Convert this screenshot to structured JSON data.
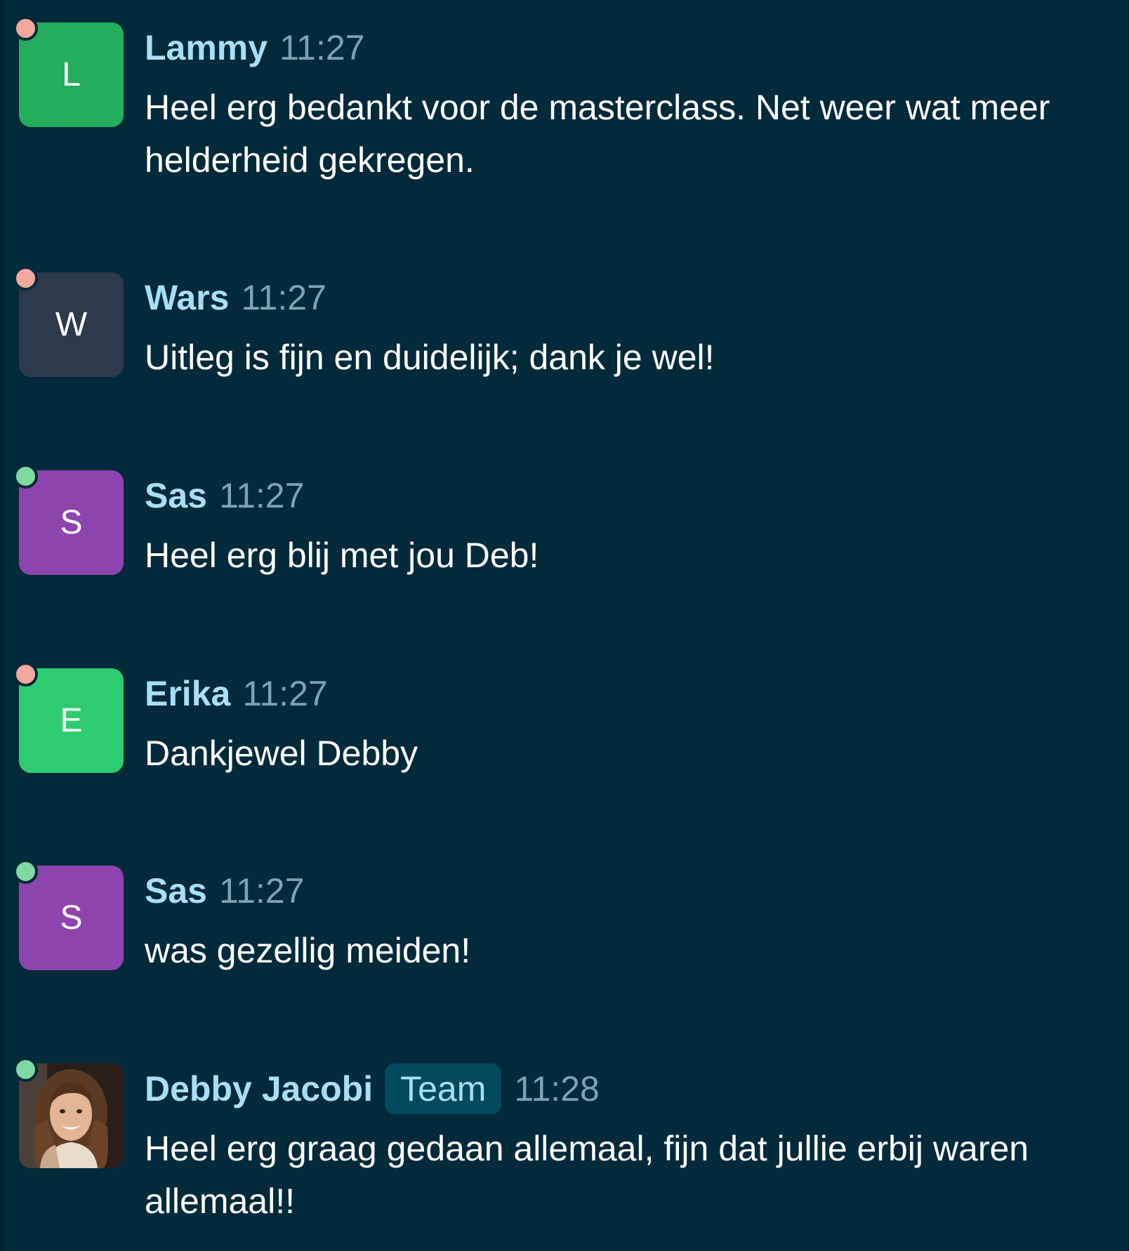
{
  "colors": {
    "background": "#032a3a",
    "name_color": "#a7dff6",
    "time_color": "#7ea2b2",
    "text_color": "#ffffff",
    "presence_away": "#f4a89c",
    "presence_online": "#7fd9a0"
  },
  "messages": [
    {
      "author": "Lammy",
      "initial": "L",
      "avatar_color": "#23ad5c",
      "presence": "away",
      "time": "11:27",
      "text": "Heel erg bedankt voor de masterclass. Net weer wat meer helderheid gekregen."
    },
    {
      "author": "Wars",
      "initial": "W",
      "avatar_color": "#2d3a4b",
      "presence": "away",
      "time": "11:27",
      "text": "Uitleg is fijn en duidelijk; dank je wel!"
    },
    {
      "author": "Sas",
      "initial": "S",
      "avatar_color": "#8e44ad",
      "presence": "online",
      "time": "11:27",
      "text": "Heel erg blij met jou Deb!"
    },
    {
      "author": "Erika",
      "initial": "E",
      "avatar_color": "#2ecc71",
      "presence": "away",
      "time": "11:27",
      "text": "Dankjewel Debby"
    },
    {
      "author": "Sas",
      "initial": "S",
      "avatar_color": "#8e44ad",
      "presence": "online",
      "time": "11:27",
      "text": "was gezellig meiden!"
    },
    {
      "author": "Debby Jacobi",
      "badge": "Team",
      "avatar": "photo",
      "presence": "online",
      "time": "11:28",
      "text": "Heel erg graag gedaan allemaal, fijn dat jullie erbij waren allemaal!!"
    }
  ]
}
